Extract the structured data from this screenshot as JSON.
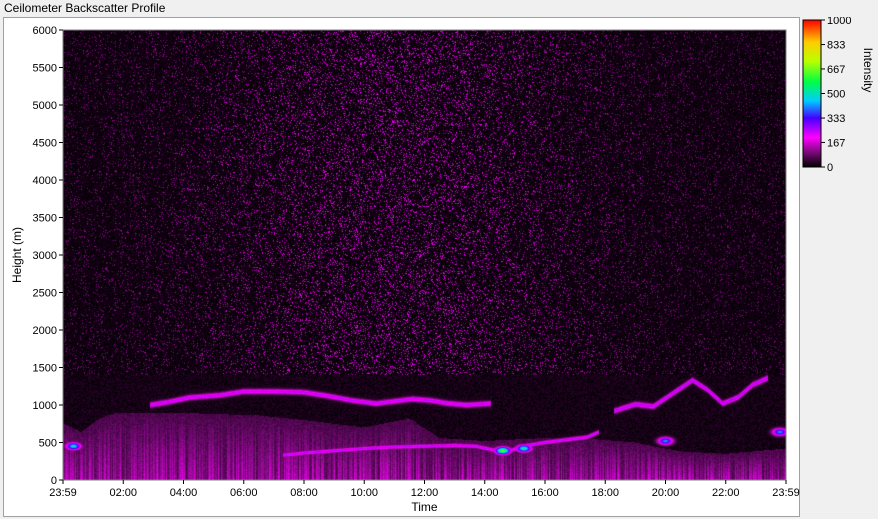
{
  "window": {
    "title": "Ceilometer Backscatter Profile"
  },
  "chart_data": {
    "type": "heatmap",
    "title": "Ceilometer Backscatter Profile",
    "xlabel": "Time",
    "ylabel": "Height (m)",
    "x_tick_labels": [
      "23:59",
      "02:00",
      "04:00",
      "06:00",
      "08:00",
      "10:00",
      "12:00",
      "14:00",
      "16:00",
      "18:00",
      "20:00",
      "22:00",
      "23:59"
    ],
    "x_tick_hours": [
      0,
      2,
      4,
      6,
      8,
      10,
      12,
      14,
      16,
      18,
      20,
      22,
      24
    ],
    "xlim_hours": [
      0,
      24
    ],
    "y_ticks": [
      0,
      500,
      1000,
      1500,
      2000,
      2500,
      3000,
      3500,
      4000,
      4500,
      5000,
      5500,
      6000
    ],
    "ylim": [
      0,
      6000
    ],
    "colorbar": {
      "label": "Intensity",
      "ticks": [
        0,
        167,
        333,
        500,
        667,
        833,
        1000
      ],
      "range": [
        0,
        1000
      ],
      "stops": [
        {
          "value": 0,
          "color": "#000000"
        },
        {
          "value": 100,
          "color": "#7a0a7a"
        },
        {
          "value": 200,
          "color": "#ff00ff"
        },
        {
          "value": 333,
          "color": "#4400ff"
        },
        {
          "value": 450,
          "color": "#00ccff"
        },
        {
          "value": 580,
          "color": "#00ff44"
        },
        {
          "value": 720,
          "color": "#bbff00"
        },
        {
          "value": 850,
          "color": "#ffcc00"
        },
        {
          "value": 1000,
          "color": "#ff0000"
        }
      ]
    },
    "features": {
      "cloud_layer_upper": [
        {
          "t": 2.9,
          "h": 1000
        },
        {
          "t": 3.5,
          "h": 1040
        },
        {
          "t": 4.2,
          "h": 1100
        },
        {
          "t": 5.2,
          "h": 1130
        },
        {
          "t": 6.0,
          "h": 1180
        },
        {
          "t": 7.0,
          "h": 1180
        },
        {
          "t": 8.0,
          "h": 1170
        },
        {
          "t": 8.8,
          "h": 1120
        },
        {
          "t": 9.6,
          "h": 1060
        },
        {
          "t": 10.4,
          "h": 1020
        },
        {
          "t": 11.0,
          "h": 1050
        },
        {
          "t": 11.6,
          "h": 1080
        },
        {
          "t": 12.2,
          "h": 1060
        },
        {
          "t": 12.8,
          "h": 1020
        },
        {
          "t": 13.4,
          "h": 1000
        },
        {
          "t": 14.2,
          "h": 1020
        }
      ],
      "cloud_layer_lower": [
        {
          "t": 7.3,
          "h": 330
        },
        {
          "t": 8.0,
          "h": 360
        },
        {
          "t": 9.0,
          "h": 390
        },
        {
          "t": 10.0,
          "h": 420
        },
        {
          "t": 11.0,
          "h": 440
        },
        {
          "t": 12.0,
          "h": 450
        },
        {
          "t": 13.0,
          "h": 460
        },
        {
          "t": 13.7,
          "h": 450
        },
        {
          "t": 14.3,
          "h": 400
        },
        {
          "t": 14.9,
          "h": 400
        },
        {
          "t": 15.4,
          "h": 460
        },
        {
          "t": 16.0,
          "h": 500
        },
        {
          "t": 16.8,
          "h": 540
        },
        {
          "t": 17.4,
          "h": 570
        },
        {
          "t": 17.8,
          "h": 640
        }
      ],
      "evening_layer": [
        {
          "t": 18.3,
          "h": 920
        },
        {
          "t": 19.0,
          "h": 1010
        },
        {
          "t": 19.6,
          "h": 980
        },
        {
          "t": 20.3,
          "h": 1170
        },
        {
          "t": 20.9,
          "h": 1330
        },
        {
          "t": 21.4,
          "h": 1200
        },
        {
          "t": 21.9,
          "h": 1020
        },
        {
          "t": 22.4,
          "h": 1100
        },
        {
          "t": 22.9,
          "h": 1270
        },
        {
          "t": 23.4,
          "h": 1360
        }
      ],
      "boundary_layer_top": [
        {
          "t": 0.0,
          "h": 760
        },
        {
          "t": 0.6,
          "h": 640
        },
        {
          "t": 1.2,
          "h": 820
        },
        {
          "t": 1.8,
          "h": 900
        },
        {
          "t": 2.4,
          "h": 900
        },
        {
          "t": 3.5,
          "h": 900
        },
        {
          "t": 5.0,
          "h": 880
        },
        {
          "t": 6.5,
          "h": 860
        },
        {
          "t": 8.0,
          "h": 800
        },
        {
          "t": 10.0,
          "h": 700
        },
        {
          "t": 11.5,
          "h": 820
        },
        {
          "t": 12.5,
          "h": 560
        },
        {
          "t": 14.0,
          "h": 520
        },
        {
          "t": 16.0,
          "h": 560
        },
        {
          "t": 17.8,
          "h": 540
        },
        {
          "t": 19.0,
          "h": 500
        },
        {
          "t": 20.5,
          "h": 380
        },
        {
          "t": 22.0,
          "h": 350
        },
        {
          "t": 24.0,
          "h": 420
        }
      ],
      "hotspots": [
        {
          "t": 0.35,
          "h": 450,
          "intensity": 480
        },
        {
          "t": 14.6,
          "h": 390,
          "intensity": 650
        },
        {
          "t": 15.3,
          "h": 420,
          "intensity": 520
        },
        {
          "t": 20.0,
          "h": 520,
          "intensity": 420
        },
        {
          "t": 23.8,
          "h": 640,
          "intensity": 420
        }
      ]
    }
  }
}
